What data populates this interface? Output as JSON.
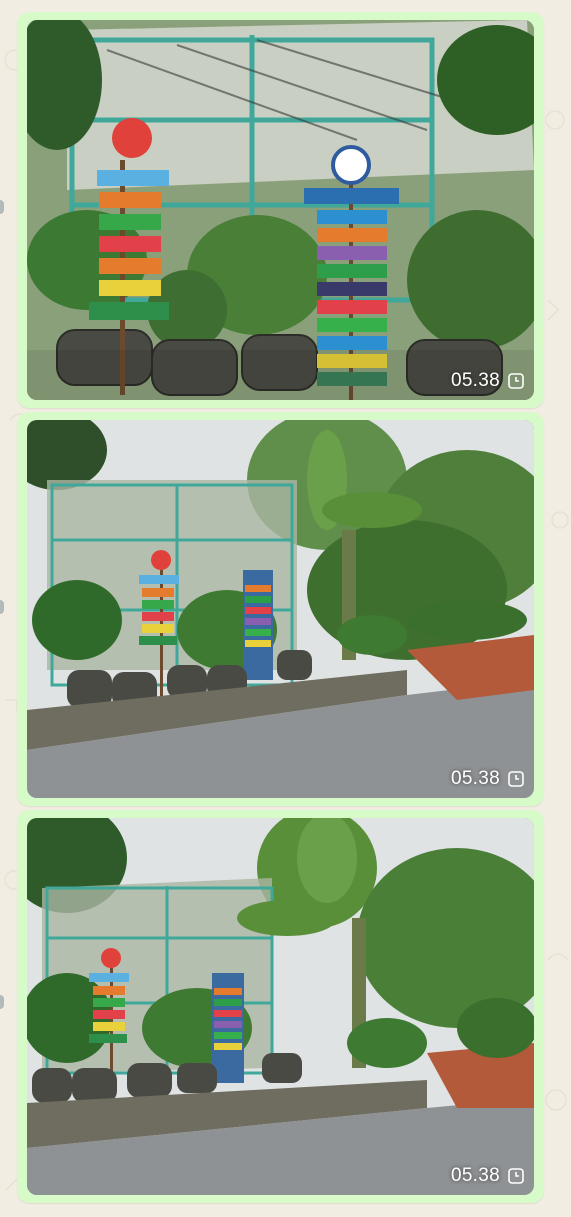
{
  "chat": {
    "messages": [
      {
        "timestamp": "05.38",
        "status_icon": "clock-icon"
      },
      {
        "timestamp": "05.38",
        "status_icon": "clock-icon"
      },
      {
        "timestamp": "05.38",
        "status_icon": "clock-icon"
      }
    ],
    "colors": {
      "bubble": "#d6fbc9",
      "wallpaper": "#f2ede3"
    }
  }
}
